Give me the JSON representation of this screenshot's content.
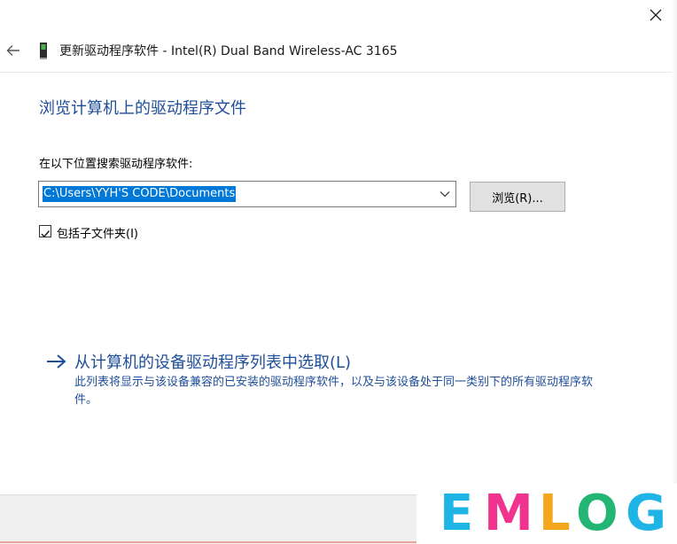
{
  "window": {
    "title": "更新驱动程序软件 - Intel(R) Dual Band Wireless-AC 3165",
    "close_icon": "close-icon",
    "back_icon": "back-arrow-icon",
    "device_icon": "network-adapter-icon"
  },
  "main": {
    "heading": "浏览计算机上的驱动程序文件",
    "path_label": "在以下位置搜索驱动程序软件:",
    "path_value": "C:\\Users\\YYH'S CODE\\Documents",
    "browse_label": "浏览(R)...",
    "include_subfolders": {
      "label": "包括子文件夹(I)",
      "checked": true
    }
  },
  "pick_option": {
    "label": "从计算机的设备驱动程序列表中选取(L)",
    "description": "此列表将显示与该设备兼容的已安装的驱动程序软件，以及与该设备处于同一类别下的所有驱动程序软件。"
  },
  "watermark": {
    "text": "EMLOG",
    "colors": [
      "#1fb4e6",
      "#f0338f",
      "#f4a71e",
      "#22b573",
      "#1fb4e6"
    ]
  },
  "colors": {
    "accent": "#1f4e9a",
    "selection": "#0078d7"
  }
}
